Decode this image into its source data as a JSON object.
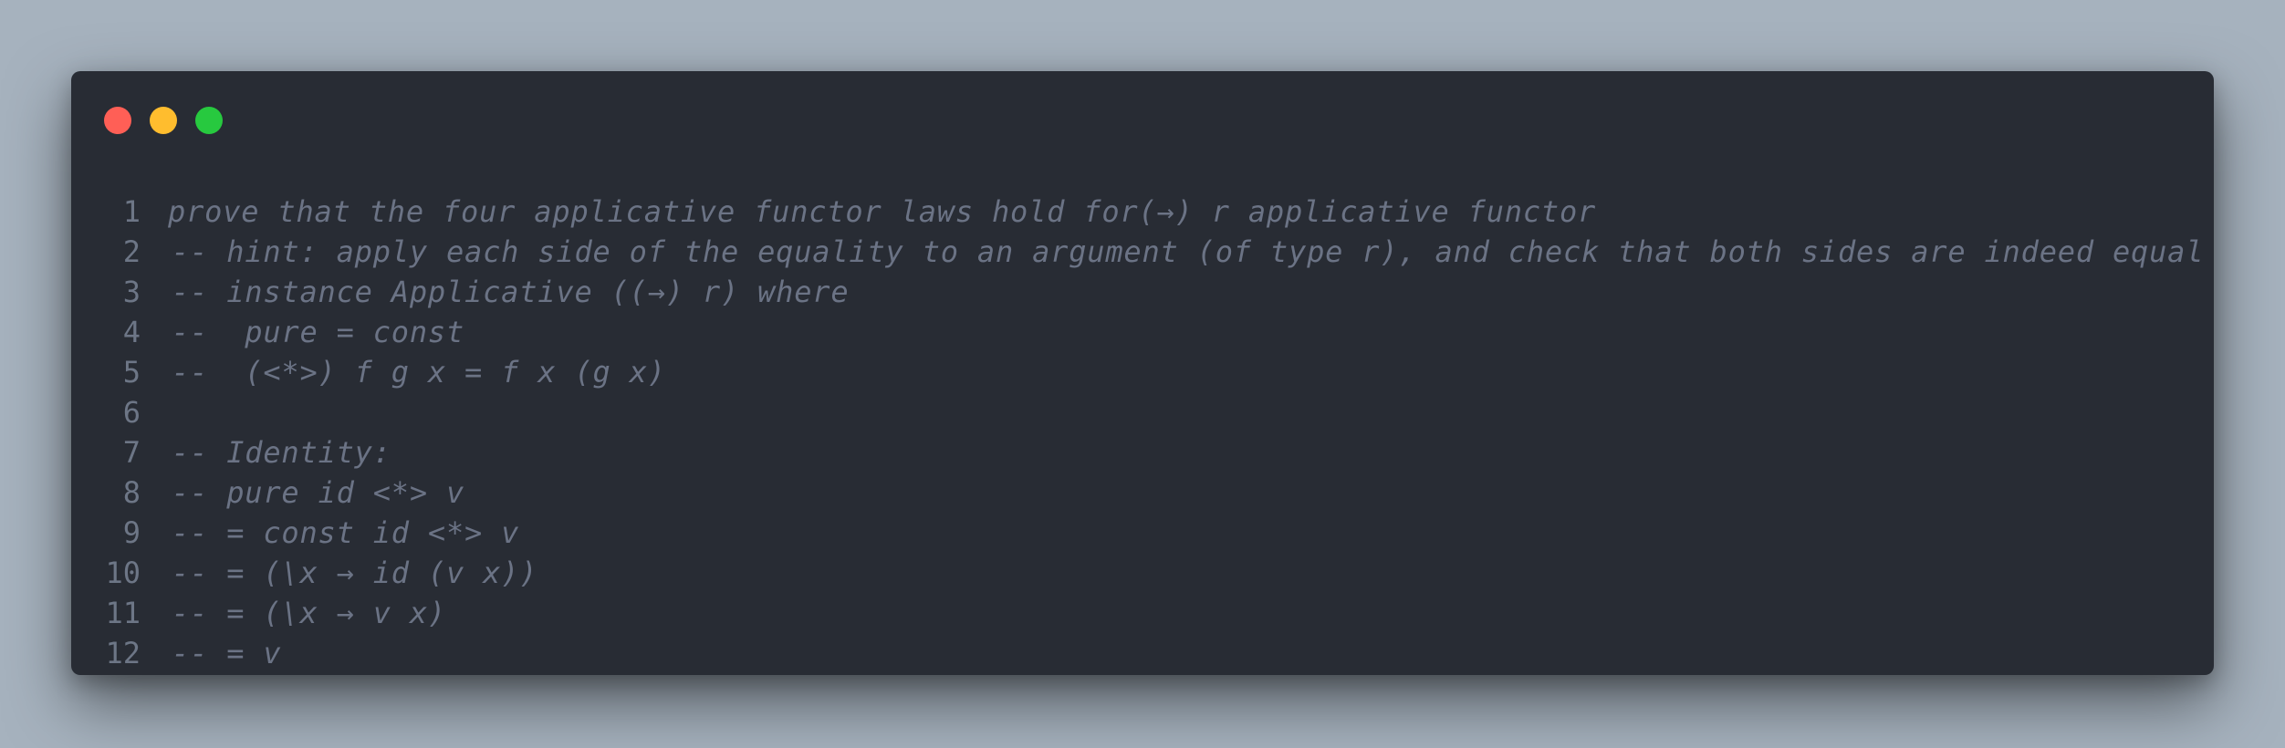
{
  "editor": {
    "lines": [
      {
        "number": "1",
        "text": "prove that the four applicative functor laws hold for(→) r applicative functor"
      },
      {
        "number": "2",
        "text": "-- hint: apply each side of the equality to an argument (of type r), and check that both sides are indeed equal"
      },
      {
        "number": "3",
        "text": "-- instance Applicative ((→) r) where"
      },
      {
        "number": "4",
        "text": "--  pure = const"
      },
      {
        "number": "5",
        "text": "--  (<*>) f g x = f x (g x)"
      },
      {
        "number": "6",
        "text": ""
      },
      {
        "number": "7",
        "text": "-- Identity:"
      },
      {
        "number": "8",
        "text": "-- pure id <*> v"
      },
      {
        "number": "9",
        "text": "-- = const id <*> v"
      },
      {
        "number": "10",
        "text": "-- = (\\x → id (v x))"
      },
      {
        "number": "11",
        "text": "-- = (\\x → v x)"
      },
      {
        "number": "12",
        "text": "-- = v"
      }
    ]
  },
  "window_controls": {
    "close_color": "#ff5f56",
    "minimize_color": "#ffbd2e",
    "zoom_color": "#27c93f"
  }
}
